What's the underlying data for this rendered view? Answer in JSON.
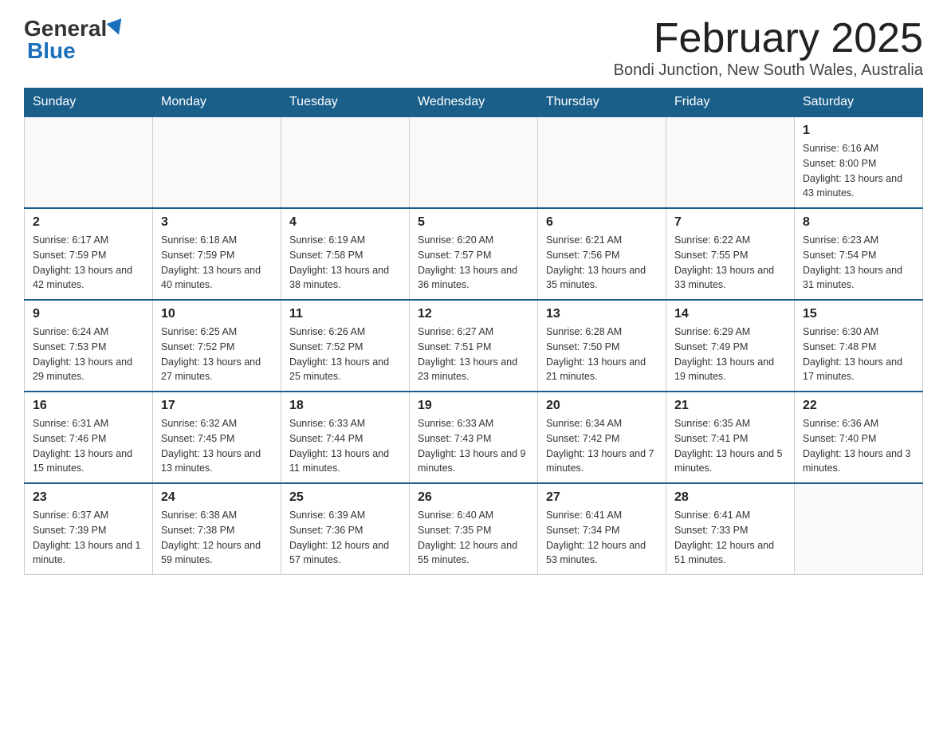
{
  "header": {
    "logo_general": "General",
    "logo_blue": "Blue",
    "month_title": "February 2025",
    "location": "Bondi Junction, New South Wales, Australia"
  },
  "weekdays": [
    "Sunday",
    "Monday",
    "Tuesday",
    "Wednesday",
    "Thursday",
    "Friday",
    "Saturday"
  ],
  "weeks": [
    [
      {
        "day": "",
        "info": ""
      },
      {
        "day": "",
        "info": ""
      },
      {
        "day": "",
        "info": ""
      },
      {
        "day": "",
        "info": ""
      },
      {
        "day": "",
        "info": ""
      },
      {
        "day": "",
        "info": ""
      },
      {
        "day": "1",
        "info": "Sunrise: 6:16 AM\nSunset: 8:00 PM\nDaylight: 13 hours and 43 minutes."
      }
    ],
    [
      {
        "day": "2",
        "info": "Sunrise: 6:17 AM\nSunset: 7:59 PM\nDaylight: 13 hours and 42 minutes."
      },
      {
        "day": "3",
        "info": "Sunrise: 6:18 AM\nSunset: 7:59 PM\nDaylight: 13 hours and 40 minutes."
      },
      {
        "day": "4",
        "info": "Sunrise: 6:19 AM\nSunset: 7:58 PM\nDaylight: 13 hours and 38 minutes."
      },
      {
        "day": "5",
        "info": "Sunrise: 6:20 AM\nSunset: 7:57 PM\nDaylight: 13 hours and 36 minutes."
      },
      {
        "day": "6",
        "info": "Sunrise: 6:21 AM\nSunset: 7:56 PM\nDaylight: 13 hours and 35 minutes."
      },
      {
        "day": "7",
        "info": "Sunrise: 6:22 AM\nSunset: 7:55 PM\nDaylight: 13 hours and 33 minutes."
      },
      {
        "day": "8",
        "info": "Sunrise: 6:23 AM\nSunset: 7:54 PM\nDaylight: 13 hours and 31 minutes."
      }
    ],
    [
      {
        "day": "9",
        "info": "Sunrise: 6:24 AM\nSunset: 7:53 PM\nDaylight: 13 hours and 29 minutes."
      },
      {
        "day": "10",
        "info": "Sunrise: 6:25 AM\nSunset: 7:52 PM\nDaylight: 13 hours and 27 minutes."
      },
      {
        "day": "11",
        "info": "Sunrise: 6:26 AM\nSunset: 7:52 PM\nDaylight: 13 hours and 25 minutes."
      },
      {
        "day": "12",
        "info": "Sunrise: 6:27 AM\nSunset: 7:51 PM\nDaylight: 13 hours and 23 minutes."
      },
      {
        "day": "13",
        "info": "Sunrise: 6:28 AM\nSunset: 7:50 PM\nDaylight: 13 hours and 21 minutes."
      },
      {
        "day": "14",
        "info": "Sunrise: 6:29 AM\nSunset: 7:49 PM\nDaylight: 13 hours and 19 minutes."
      },
      {
        "day": "15",
        "info": "Sunrise: 6:30 AM\nSunset: 7:48 PM\nDaylight: 13 hours and 17 minutes."
      }
    ],
    [
      {
        "day": "16",
        "info": "Sunrise: 6:31 AM\nSunset: 7:46 PM\nDaylight: 13 hours and 15 minutes."
      },
      {
        "day": "17",
        "info": "Sunrise: 6:32 AM\nSunset: 7:45 PM\nDaylight: 13 hours and 13 minutes."
      },
      {
        "day": "18",
        "info": "Sunrise: 6:33 AM\nSunset: 7:44 PM\nDaylight: 13 hours and 11 minutes."
      },
      {
        "day": "19",
        "info": "Sunrise: 6:33 AM\nSunset: 7:43 PM\nDaylight: 13 hours and 9 minutes."
      },
      {
        "day": "20",
        "info": "Sunrise: 6:34 AM\nSunset: 7:42 PM\nDaylight: 13 hours and 7 minutes."
      },
      {
        "day": "21",
        "info": "Sunrise: 6:35 AM\nSunset: 7:41 PM\nDaylight: 13 hours and 5 minutes."
      },
      {
        "day": "22",
        "info": "Sunrise: 6:36 AM\nSunset: 7:40 PM\nDaylight: 13 hours and 3 minutes."
      }
    ],
    [
      {
        "day": "23",
        "info": "Sunrise: 6:37 AM\nSunset: 7:39 PM\nDaylight: 13 hours and 1 minute."
      },
      {
        "day": "24",
        "info": "Sunrise: 6:38 AM\nSunset: 7:38 PM\nDaylight: 12 hours and 59 minutes."
      },
      {
        "day": "25",
        "info": "Sunrise: 6:39 AM\nSunset: 7:36 PM\nDaylight: 12 hours and 57 minutes."
      },
      {
        "day": "26",
        "info": "Sunrise: 6:40 AM\nSunset: 7:35 PM\nDaylight: 12 hours and 55 minutes."
      },
      {
        "day": "27",
        "info": "Sunrise: 6:41 AM\nSunset: 7:34 PM\nDaylight: 12 hours and 53 minutes."
      },
      {
        "day": "28",
        "info": "Sunrise: 6:41 AM\nSunset: 7:33 PM\nDaylight: 12 hours and 51 minutes."
      },
      {
        "day": "",
        "info": ""
      }
    ]
  ]
}
